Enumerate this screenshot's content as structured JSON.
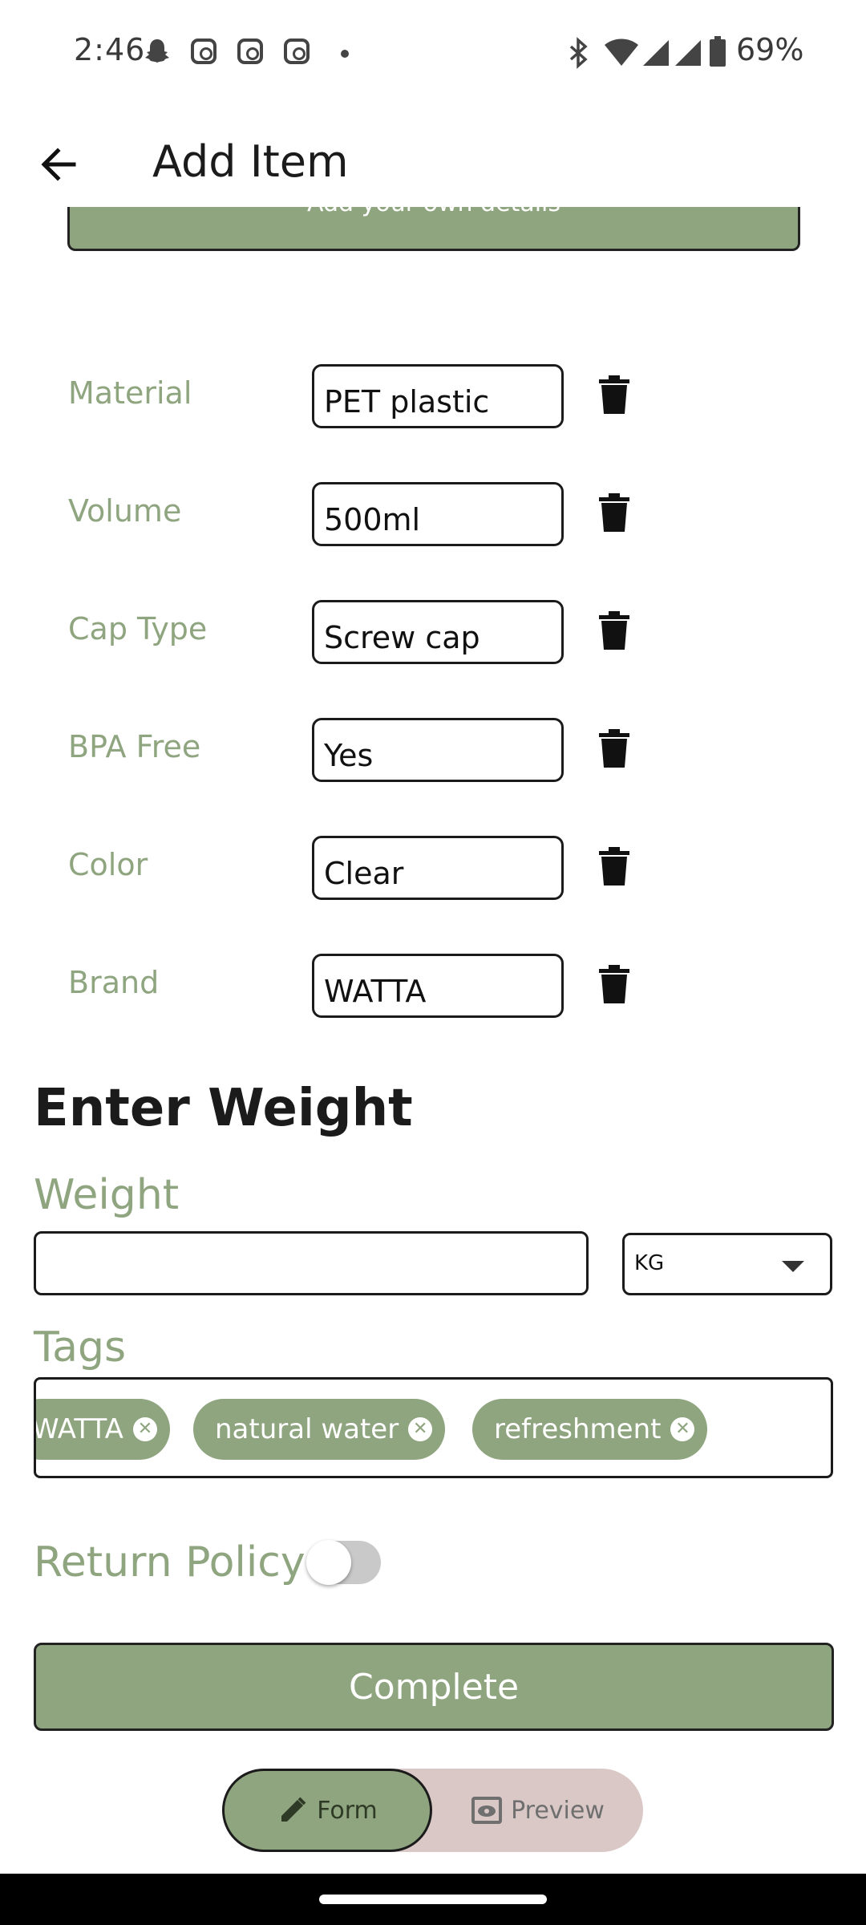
{
  "status": {
    "time": "2:46",
    "battery": "69%"
  },
  "header": {
    "title": "Add Item"
  },
  "banner": {
    "text": "Add your own details"
  },
  "attributes": [
    {
      "label": "Material",
      "value": "PET plastic"
    },
    {
      "label": "Volume",
      "value": "500ml"
    },
    {
      "label": "Cap Type",
      "value": "Screw cap"
    },
    {
      "label": "BPA Free",
      "value": "Yes"
    },
    {
      "label": "Color",
      "value": "Clear"
    },
    {
      "label": "Brand",
      "value": "WATTA"
    }
  ],
  "weight": {
    "section_title": "Enter Weight",
    "label": "Weight",
    "value": "",
    "unit": "KG"
  },
  "tags": {
    "label": "Tags",
    "items": [
      "WATTA",
      "natural water",
      "refreshment"
    ]
  },
  "return_policy": {
    "label": "Return Policy",
    "enabled": false
  },
  "actions": {
    "complete": "Complete"
  },
  "modes": {
    "form": "Form",
    "preview": "Preview",
    "active": "form"
  },
  "colors": {
    "accent": "#8fa57f",
    "preview_bg": "#d9c8c6"
  }
}
